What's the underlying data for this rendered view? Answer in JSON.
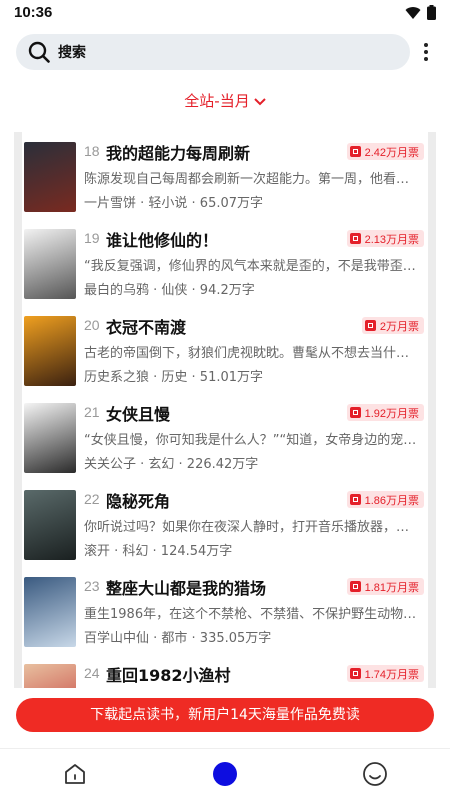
{
  "status": {
    "time": "10:36"
  },
  "search": {
    "label": "搜索"
  },
  "filter": {
    "label": "全站-当月"
  },
  "books": [
    {
      "rank": "18",
      "title": "我的超能力每周刷新",
      "votes": "2.42万月票",
      "desc": "陈源发现自己每周都会刷新一次超能力。第一周，他看…",
      "meta": "一片雪饼 · 轻小说 · 65.07万字",
      "cover_colors": [
        "#2a2f3a",
        "#7a2a20"
      ]
    },
    {
      "rank": "19",
      "title": "谁让他修仙的！",
      "votes": "2.13万月票",
      "desc": "“我反复强调，修仙界的风气本来就是歪的，不是我带歪…",
      "meta": "最白的乌鸦 · 仙侠 · 94.2万字",
      "cover_colors": [
        "#f2f2f2",
        "#555555"
      ]
    },
    {
      "rank": "20",
      "title": "衣冠不南渡",
      "votes": "2万月票",
      "desc": "古老的帝国倒下，豺狼们虎视眈眈。曹髦从不想去当什…",
      "meta": "历史系之狼 · 历史 · 51.01万字",
      "cover_colors": [
        "#f0a020",
        "#3a2010"
      ]
    },
    {
      "rank": "21",
      "title": "女侠且慢",
      "votes": "1.92万月票",
      "desc": "“女侠且慢，你可知我是什么人？”“知道，女帝身边的宠…",
      "meta": "关关公子 · 玄幻 · 226.42万字",
      "cover_colors": [
        "#f5f5f5",
        "#2a2a2a"
      ]
    },
    {
      "rank": "22",
      "title": "隐秘死角",
      "votes": "1.86万月票",
      "desc": "你听说过吗？如果你在夜深人静时，打开音乐播放器，…",
      "meta": "滚开 · 科幻 · 124.54万字",
      "cover_colors": [
        "#5a6a6a",
        "#1a2020"
      ]
    },
    {
      "rank": "23",
      "title": "整座大山都是我的猎场",
      "votes": "1.81万月票",
      "desc": "重生1986年，在这个不禁枪、不禁猎、不保护野生动物…",
      "meta": "百学山中仙 · 都市 · 335.05万字",
      "cover_colors": [
        "#3a5a80",
        "#c8d8e8"
      ]
    },
    {
      "rank": "24",
      "title": "重回1982小渔村",
      "votes": "1.74万月票",
      "desc": "",
      "meta": "",
      "cover_colors": [
        "#e8c0a0",
        "#c03030"
      ]
    }
  ],
  "promo": {
    "text": "下载起点读书，新用户14天海量作品免费读"
  },
  "tabs": [
    "home-icon",
    "center-dot-icon",
    "profile-icon"
  ],
  "accent_color": "#e4202a"
}
